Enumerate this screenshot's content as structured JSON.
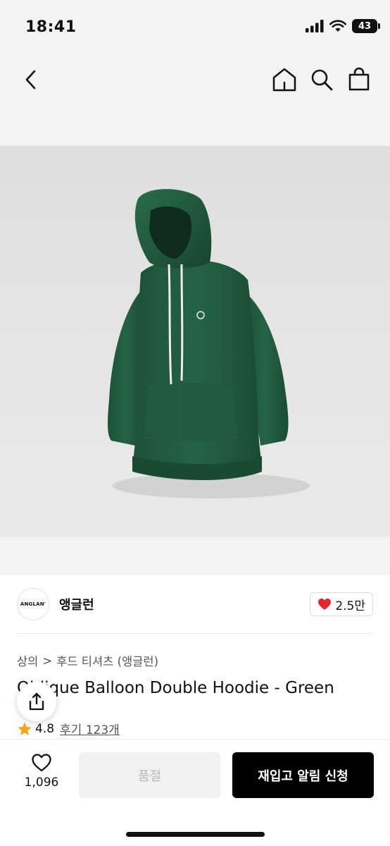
{
  "status_bar": {
    "time": "18:41",
    "battery": "43"
  },
  "brand": {
    "logo_text": "ANGLAN'",
    "name": "앵글런"
  },
  "likes": {
    "count": "2.5만"
  },
  "breadcrumb": {
    "level1": "상의",
    "separator": ">",
    "level2": "후드 티셔츠 (앵글런)"
  },
  "product": {
    "title": "Oblique Balloon Double Hoodie - Green"
  },
  "rating": {
    "score": "4.8",
    "reviews": "후기 123개"
  },
  "wishlist": {
    "count": "1,096"
  },
  "buttons": {
    "sold_out": "품절",
    "restock": "재입고 알림 신청"
  },
  "colors": {
    "accent": "#000000",
    "heart": "#e5262c",
    "star": "#f4a51c",
    "hoodie": "#1f5a3e"
  }
}
